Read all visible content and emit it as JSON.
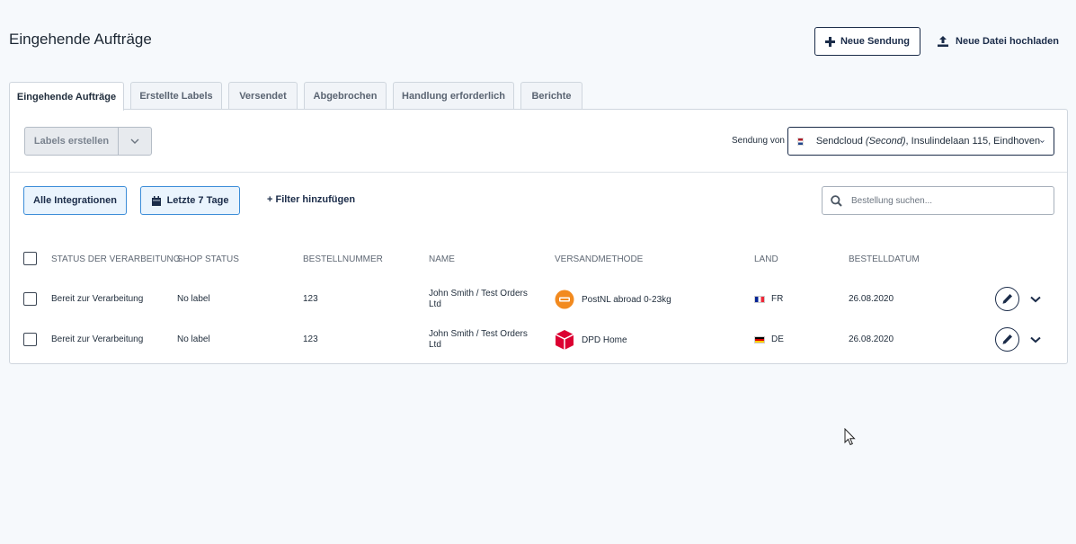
{
  "header": {
    "title": "Eingehende Aufträge",
    "new_shipment": "Neue Sendung",
    "upload_file": "Neue Datei hochladen"
  },
  "tabs": [
    {
      "label": "Eingehende Aufträge",
      "active": true
    },
    {
      "label": "Erstellte Labels",
      "active": false
    },
    {
      "label": "Versendet",
      "active": false
    },
    {
      "label": "Abgebrochen",
      "active": false
    },
    {
      "label": "Handlung erforderlich",
      "active": false
    },
    {
      "label": "Berichte",
      "active": false
    }
  ],
  "toolbar": {
    "create_labels": "Labels erstellen",
    "sender_label": "Sendung von",
    "sender_name": "Sendcloud",
    "sender_tag": "(Second)",
    "sender_address": ", Insulindelaan 115, Eindhoven"
  },
  "filters": {
    "integrations": "Alle Integrationen",
    "date_range": "Letzte 7 Tage",
    "add_filter": "+ Filter hinzufügen",
    "search_placeholder": "Bestellung suchen..."
  },
  "table": {
    "columns": [
      "Status der Verarbeitung",
      "Shop Status",
      "Bestellnummer",
      "Name",
      "Versandmethode",
      "Land",
      "Bestelldatum"
    ],
    "rows": [
      {
        "status": "Bereit zur Verarbeitung",
        "shop_status": "No label",
        "order_number": "123",
        "name": "John Smith / Test Orders Ltd",
        "method": "PostNL abroad 0-23kg",
        "carrier_icon": "postnl-logo-icon",
        "country": "FR",
        "date": "26.08.2020"
      },
      {
        "status": "Bereit zur Verarbeitung",
        "shop_status": "No label",
        "order_number": "123",
        "name": "John Smith / Test Orders Ltd",
        "method": "DPD Home",
        "carrier_icon": "dpd-logo-icon",
        "country": "DE",
        "date": "26.08.2020"
      }
    ]
  },
  "colors": {
    "primary": "#1b2c49",
    "accent": "#3c8dd8",
    "background": "#f6f9fc",
    "postnl": "#f28a1f",
    "dpd": "#dc0032"
  }
}
